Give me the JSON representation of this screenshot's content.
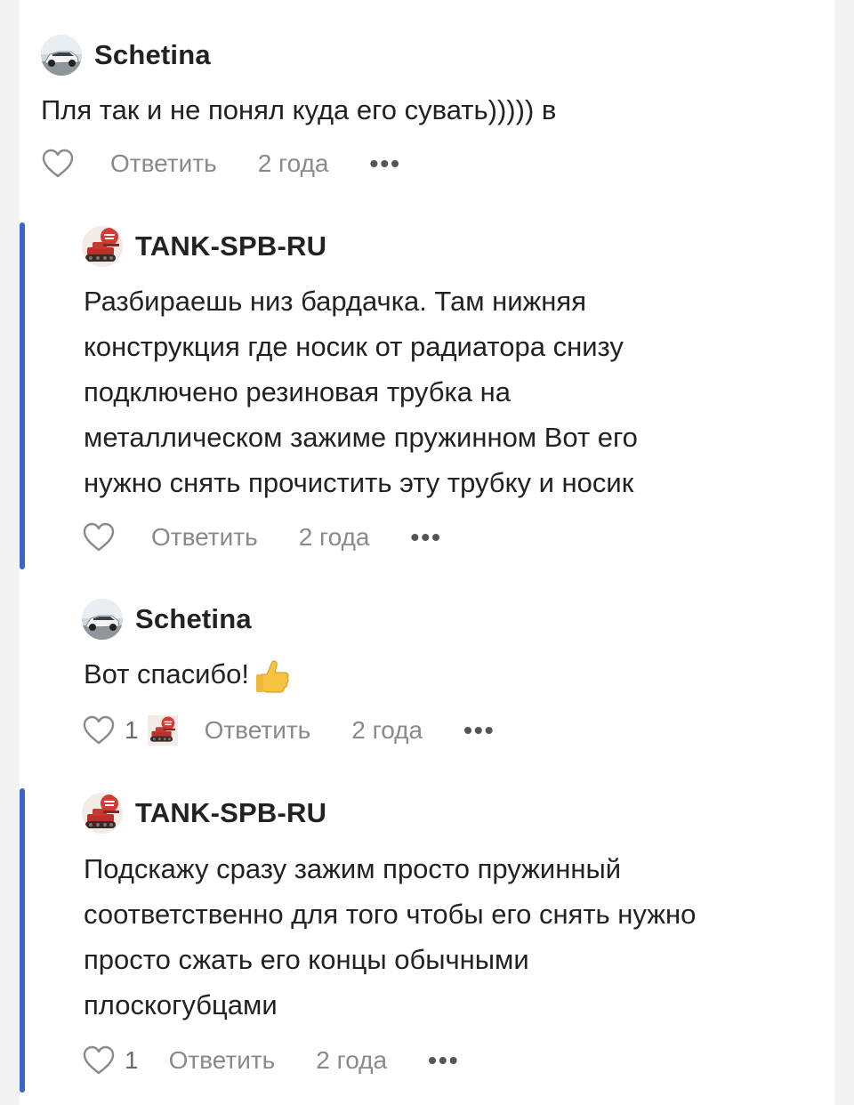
{
  "comments": [
    {
      "author": "Schetina",
      "avatar_icon": "car-avatar",
      "text": "Пля так и не понял куда его сувать))))) в",
      "likes": "",
      "reply_label": "Ответить",
      "age": "2 года",
      "more": "•••"
    },
    {
      "author": "TANK-SPB-RU",
      "avatar_icon": "tank-avatar",
      "lines": [
        "Разбираешь низ бардачка. Там нижняя",
        "конструкция где носик от радиатора снизу",
        "подключено резиновая трубка на",
        "металлическом зажиме пружинном Вот его",
        "нужно снять прочистить эту трубку и носик"
      ],
      "likes": "",
      "reply_label": "Ответить",
      "age": "2 года",
      "more": "•••"
    },
    {
      "author": "Schetina",
      "avatar_icon": "car-avatar",
      "text": "Вот спасибо!",
      "emoji_icon": "thumbs-up-icon",
      "likes": "1",
      "reply_label": "Ответить",
      "age": "2 года",
      "more": "•••"
    },
    {
      "author": "TANK-SPB-RU",
      "avatar_icon": "tank-avatar",
      "lines": [
        "Подскажу сразу зажим просто пружинный",
        "соответственно для того чтобы его снять нужно",
        "просто сжать его концы обычными",
        "плоскогубцами"
      ],
      "likes": "1",
      "reply_label": "Ответить",
      "age": "2 года",
      "more": "•••"
    }
  ],
  "colors": {
    "thread_bar": "#3b67c9",
    "meta_text": "#8a8a8a"
  }
}
